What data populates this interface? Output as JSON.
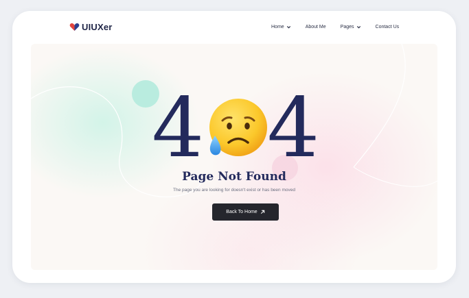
{
  "brand": {
    "name": "UIUXer"
  },
  "nav": {
    "items": [
      {
        "label": "Home",
        "dropdown": true
      },
      {
        "label": "About Me",
        "dropdown": false
      },
      {
        "label": "Pages",
        "dropdown": true
      },
      {
        "label": "Contact Us",
        "dropdown": false
      }
    ]
  },
  "error": {
    "digit_left": "4",
    "digit_right": "4",
    "emoji": "sad-relieved-face-with-tear",
    "title": "Page Not Found",
    "message": "The page you are looking for doesn't exist or has been moved",
    "button_label": "Back To Home",
    "button_icon": "arrow-up-right-icon"
  },
  "colors": {
    "navy": "#232a5c",
    "button": "#25262d",
    "mint": "#b2f0de",
    "pink": "#fcd2e2"
  }
}
